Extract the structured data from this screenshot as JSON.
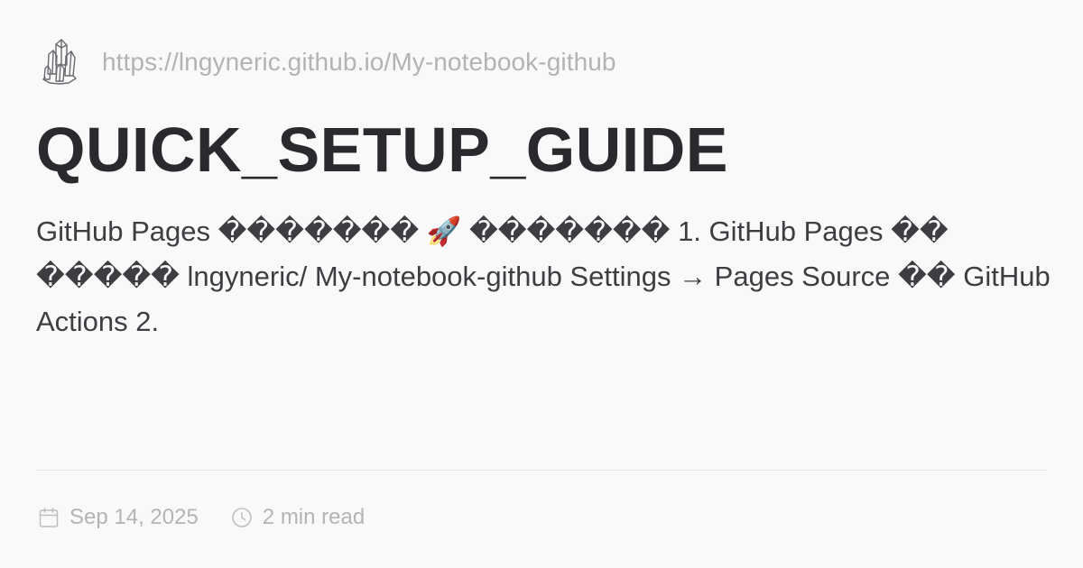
{
  "site": {
    "logo_icon": "crystal-cluster-icon",
    "url": "https://lngyneric.github.io/My-notebook-github"
  },
  "post": {
    "title": "QUICK_SETUP_GUIDE",
    "excerpt": "GitHub Pages ������� 🚀 ������� 1. GitHub Pages �� ����� lngyneric/ My-notebook-github Settings → Pages Source �� GitHub Actions 2."
  },
  "meta": {
    "date_icon": "calendar-icon",
    "date": "Sep 14, 2025",
    "read_icon": "clock-icon",
    "read_time": "2 min read"
  },
  "colors": {
    "background": "#faf9fa",
    "title": "#2a2a2e",
    "text": "#3d3d42",
    "muted": "#b4b4b7",
    "divider": "#e7e5e8"
  }
}
